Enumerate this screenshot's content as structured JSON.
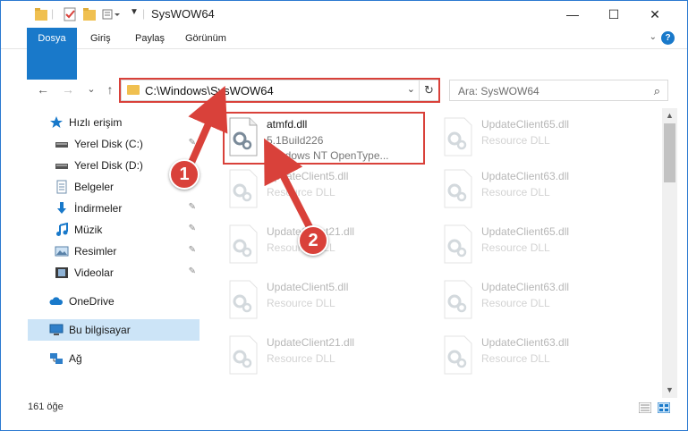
{
  "window": {
    "title": "SysWOW64",
    "controls": {
      "minimize": "—",
      "maximize": "☐",
      "close": "✕"
    }
  },
  "ribbon": {
    "tabs": [
      {
        "label": "Dosya"
      },
      {
        "label": "Giriş"
      },
      {
        "label": "Paylaş"
      },
      {
        "label": "Görünüm"
      }
    ],
    "expand_icon": "chevron-down-icon",
    "help_label": "?"
  },
  "navigation": {
    "back": "←",
    "forward": "→",
    "recent": "⌄",
    "up": "↑"
  },
  "address": {
    "path": "C:\\Windows\\SysWOW64",
    "dropdown": "⌄",
    "refresh": "↻"
  },
  "search": {
    "placeholder": "Ara: SysWOW64",
    "icon": "⌕"
  },
  "sidebar": {
    "items": [
      {
        "label": "Hızlı erişim",
        "icon": "star-icon"
      },
      {
        "label": "Yerel Disk (C:)",
        "icon": "drive-icon",
        "pinned": true
      },
      {
        "label": "Yerel Disk (D:)",
        "icon": "drive-icon"
      },
      {
        "label": "Belgeler",
        "icon": "documents-icon"
      },
      {
        "label": "İndirmeler",
        "icon": "download-icon",
        "pinned": true
      },
      {
        "label": "Müzik",
        "icon": "music-icon",
        "pinned": true
      },
      {
        "label": "Resimler",
        "icon": "pictures-icon",
        "pinned": true
      },
      {
        "label": "Videolar",
        "icon": "video-icon",
        "pinned": true
      },
      {
        "label": "OneDrive",
        "icon": "cloud-icon"
      },
      {
        "label": "Bu bilgisayar",
        "icon": "computer-icon",
        "selected": true
      },
      {
        "label": "Ağ",
        "icon": "network-icon"
      }
    ],
    "pin_glyph": "📌"
  },
  "files": {
    "left": [
      {
        "name": "atmfd.dll",
        "line2": "5.1Build226",
        "line3": "Windows NT OpenType..."
      },
      {
        "name": "UpdateClient5.dll",
        "line2": "Resource DLL"
      },
      {
        "name": "UpdateClient21.dll",
        "line2": "Resource DLL"
      },
      {
        "name": "UpdateClient5.dll",
        "line2": "Resource DLL"
      },
      {
        "name": "UpdateClient21.dll",
        "line2": "Resource DLL"
      }
    ],
    "right": [
      {
        "name": "UpdateClient65.dll",
        "line2": "Resource DLL"
      },
      {
        "name": "UpdateClient63.dll",
        "line2": "Resource DLL"
      },
      {
        "name": "UpdateClient65.dll",
        "line2": "Resource DLL"
      },
      {
        "name": "UpdateClient63.dll",
        "line2": "Resource DLL"
      },
      {
        "name": "UpdateClient63.dll",
        "line2": "Resource DLL"
      }
    ]
  },
  "status": {
    "count": "161 öğe"
  },
  "callouts": {
    "one": "1",
    "two": "2"
  },
  "colors": {
    "accent": "#1979ca",
    "highlight": "#d9413a",
    "selected": "#cce4f7"
  }
}
